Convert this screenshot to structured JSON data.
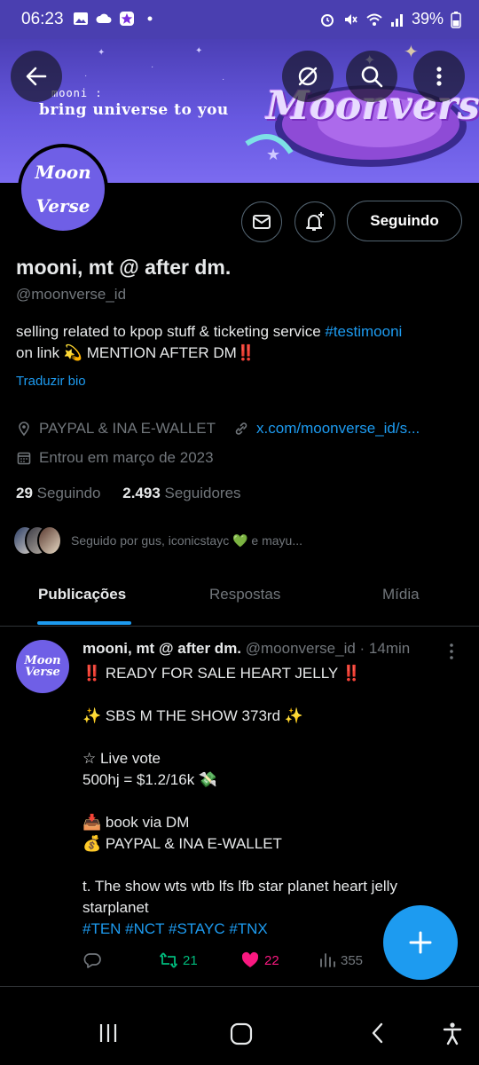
{
  "status_bar": {
    "time": "06:23",
    "battery": "39%",
    "icons_left": [
      "gallery-icon",
      "cloud-icon",
      "app-icon",
      "dot-icon"
    ],
    "icons_right": [
      "alarm-icon",
      "mute-icon",
      "wifi-icon",
      "signal-icon",
      "battery-icon"
    ]
  },
  "banner": {
    "tagline_top": "mooni :",
    "tagline": "bring universe to you",
    "brand": "Moonverse"
  },
  "header": {
    "back_icon": "arrow-left-icon",
    "right_icons": [
      "grok-icon",
      "search-icon",
      "more-vertical-icon"
    ]
  },
  "profile": {
    "avatar_text_1": "Moon",
    "avatar_text_2": "Verse",
    "name": "mooni, mt @ after dm.",
    "handle": "@moonverse_id",
    "bio_text": "selling related to kpop stuff & ticketing service ",
    "bio_hashtag": "#testimooni",
    "bio_line2": "on link 💫 MENTION AFTER DM‼️",
    "translate_label": "Traduzir bio",
    "location": "PAYPAL & INA E-WALLET",
    "website": "x.com/moonverse_id/s...",
    "joined": "Entrou em março de 2023",
    "following_count": "29",
    "following_label": "Seguindo",
    "followers_count": "2.493",
    "followers_label": "Seguidores",
    "followed_by": "Seguido por gus, iconicstayc 💚 e mayu..."
  },
  "actions": {
    "follow_label": "Seguindo"
  },
  "tabs": [
    {
      "label": "Publicações",
      "active": true
    },
    {
      "label": "Respostas",
      "active": false
    },
    {
      "label": "Mídia",
      "active": false
    }
  ],
  "post": {
    "author": "mooni, mt @ after dm.",
    "handle": "@moonverse_id",
    "time": "· 14min",
    "lines": [
      "‼️ READY FOR SALE HEART JELLY ‼️",
      "",
      "✨ SBS M THE SHOW 373rd ✨",
      "",
      "☆ Live vote",
      "500hj = $1.2/16k 💸",
      "",
      "📥 book via DM",
      "💰 PAYPAL & INA E-WALLET",
      "",
      "t. The show wts wtb lfs lfb star planet heart jelly starplanet"
    ],
    "hashtags": "#TEN #NCT #STAYC #TNX",
    "retweets": "21",
    "likes": "22",
    "views": "355"
  },
  "colors": {
    "accent": "#1d9bf0",
    "banner": "#6758e0",
    "retweet": "#00ba7c",
    "like": "#f91880"
  }
}
